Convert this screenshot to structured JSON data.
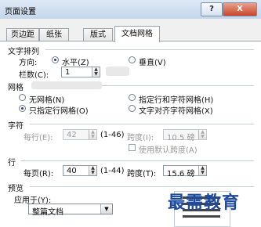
{
  "window": {
    "title": "页面设置",
    "help_label": "?",
    "close_label": "X"
  },
  "tabs": [
    {
      "label": "页边距",
      "active": false
    },
    {
      "label": "纸张",
      "active": false
    },
    {
      "label": "版式",
      "active": false
    },
    {
      "label": "文档网格",
      "active": true
    }
  ],
  "text_direction": {
    "section_label": "文字排列",
    "direction_label": "方向:",
    "horizontal_label": "水平(Z)",
    "vertical_label": "垂直(V)",
    "selected": "horizontal",
    "columns_label": "栏数(C):",
    "columns_value": "1"
  },
  "grid": {
    "section_label": "网格",
    "options": [
      {
        "label": "无网格(N)",
        "selected": false
      },
      {
        "label": "指定行和字符网格(H)",
        "selected": false
      },
      {
        "label": "只指定行网格(O)",
        "selected": true
      },
      {
        "label": "文字对齐字符网格(X)",
        "selected": false
      }
    ]
  },
  "characters": {
    "section_label": "字符",
    "per_line_label": "每行(E):",
    "per_line_value": "42",
    "per_line_range": "(1-46)",
    "spacing_label": "跨度(I):",
    "spacing_value": "10.5 磅",
    "default_spacing_label": "使用默认跨度(A)",
    "enabled": false
  },
  "lines": {
    "section_label": "行",
    "per_page_label": "每页(R):",
    "per_page_value": "40",
    "per_page_range": "(1-44)",
    "spacing_label": "跨度(T):",
    "spacing_value": "15.6 磅"
  },
  "preview": {
    "section_label": "预览",
    "apply_to_label": "应用于(Y):",
    "apply_to_value": "整篇文档"
  },
  "watermark": {
    "text": "最需教育"
  }
}
